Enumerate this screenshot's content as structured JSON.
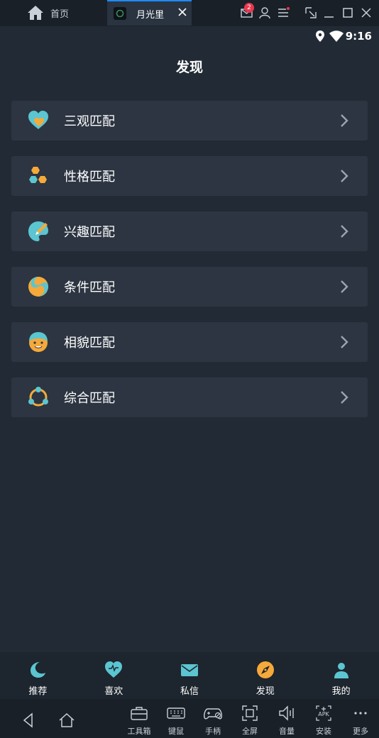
{
  "chrome": {
    "home_tab_label": "首页",
    "app_tab_label": "月光里",
    "notification_count": "2"
  },
  "statusbar": {
    "time": "9:16"
  },
  "page": {
    "title": "发现"
  },
  "match_items": [
    {
      "label": "三观匹配",
      "icon": "heart-hand-icon"
    },
    {
      "label": "性格匹配",
      "icon": "hexagons-icon"
    },
    {
      "label": "兴趣匹配",
      "icon": "palette-icon"
    },
    {
      "label": "条件匹配",
      "icon": "swirl-icon"
    },
    {
      "label": "相貌匹配",
      "icon": "face-icon"
    },
    {
      "label": "综合匹配",
      "icon": "group-circle-icon"
    }
  ],
  "bottom_nav": [
    {
      "label": "推荐",
      "icon": "moon-icon"
    },
    {
      "label": "喜欢",
      "icon": "heart-icon"
    },
    {
      "label": "私信",
      "icon": "mail-icon"
    },
    {
      "label": "发现",
      "icon": "compass-icon",
      "active": true
    },
    {
      "label": "我的",
      "icon": "person-icon"
    }
  ],
  "toolbar": [
    {
      "label": "工具箱",
      "icon": "toolbox-icon"
    },
    {
      "label": "键鼠",
      "icon": "keyboard-icon"
    },
    {
      "label": "手柄",
      "icon": "gamepad-icon"
    },
    {
      "label": "全屏",
      "icon": "fullscreen-icon"
    },
    {
      "label": "音量",
      "icon": "volume-icon"
    },
    {
      "label": "安装",
      "icon": "apk-icon"
    },
    {
      "label": "更多",
      "icon": "more-icon"
    }
  ],
  "colors": {
    "background": "#222b35",
    "card": "#2c3541",
    "accent_teal": "#5bc5d1",
    "accent_orange": "#f5a93a",
    "chrome": "#1a2028",
    "tab_highlight": "#1e8bff"
  }
}
